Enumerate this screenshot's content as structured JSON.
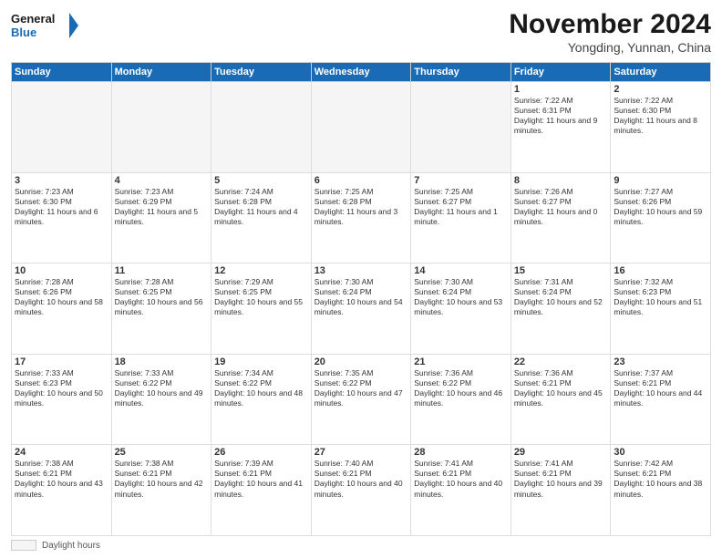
{
  "logo": {
    "line1": "General",
    "line2": "Blue"
  },
  "title": "November 2024",
  "subtitle": "Yongding, Yunnan, China",
  "days_of_week": [
    "Sunday",
    "Monday",
    "Tuesday",
    "Wednesday",
    "Thursday",
    "Friday",
    "Saturday"
  ],
  "footer_label": "Daylight hours",
  "weeks": [
    [
      {
        "day": "",
        "info": ""
      },
      {
        "day": "",
        "info": ""
      },
      {
        "day": "",
        "info": ""
      },
      {
        "day": "",
        "info": ""
      },
      {
        "day": "",
        "info": ""
      },
      {
        "day": "1",
        "info": "Sunrise: 7:22 AM\nSunset: 6:31 PM\nDaylight: 11 hours and 9 minutes."
      },
      {
        "day": "2",
        "info": "Sunrise: 7:22 AM\nSunset: 6:30 PM\nDaylight: 11 hours and 8 minutes."
      }
    ],
    [
      {
        "day": "3",
        "info": "Sunrise: 7:23 AM\nSunset: 6:30 PM\nDaylight: 11 hours and 6 minutes."
      },
      {
        "day": "4",
        "info": "Sunrise: 7:23 AM\nSunset: 6:29 PM\nDaylight: 11 hours and 5 minutes."
      },
      {
        "day": "5",
        "info": "Sunrise: 7:24 AM\nSunset: 6:28 PM\nDaylight: 11 hours and 4 minutes."
      },
      {
        "day": "6",
        "info": "Sunrise: 7:25 AM\nSunset: 6:28 PM\nDaylight: 11 hours and 3 minutes."
      },
      {
        "day": "7",
        "info": "Sunrise: 7:25 AM\nSunset: 6:27 PM\nDaylight: 11 hours and 1 minute."
      },
      {
        "day": "8",
        "info": "Sunrise: 7:26 AM\nSunset: 6:27 PM\nDaylight: 11 hours and 0 minutes."
      },
      {
        "day": "9",
        "info": "Sunrise: 7:27 AM\nSunset: 6:26 PM\nDaylight: 10 hours and 59 minutes."
      }
    ],
    [
      {
        "day": "10",
        "info": "Sunrise: 7:28 AM\nSunset: 6:26 PM\nDaylight: 10 hours and 58 minutes."
      },
      {
        "day": "11",
        "info": "Sunrise: 7:28 AM\nSunset: 6:25 PM\nDaylight: 10 hours and 56 minutes."
      },
      {
        "day": "12",
        "info": "Sunrise: 7:29 AM\nSunset: 6:25 PM\nDaylight: 10 hours and 55 minutes."
      },
      {
        "day": "13",
        "info": "Sunrise: 7:30 AM\nSunset: 6:24 PM\nDaylight: 10 hours and 54 minutes."
      },
      {
        "day": "14",
        "info": "Sunrise: 7:30 AM\nSunset: 6:24 PM\nDaylight: 10 hours and 53 minutes."
      },
      {
        "day": "15",
        "info": "Sunrise: 7:31 AM\nSunset: 6:24 PM\nDaylight: 10 hours and 52 minutes."
      },
      {
        "day": "16",
        "info": "Sunrise: 7:32 AM\nSunset: 6:23 PM\nDaylight: 10 hours and 51 minutes."
      }
    ],
    [
      {
        "day": "17",
        "info": "Sunrise: 7:33 AM\nSunset: 6:23 PM\nDaylight: 10 hours and 50 minutes."
      },
      {
        "day": "18",
        "info": "Sunrise: 7:33 AM\nSunset: 6:22 PM\nDaylight: 10 hours and 49 minutes."
      },
      {
        "day": "19",
        "info": "Sunrise: 7:34 AM\nSunset: 6:22 PM\nDaylight: 10 hours and 48 minutes."
      },
      {
        "day": "20",
        "info": "Sunrise: 7:35 AM\nSunset: 6:22 PM\nDaylight: 10 hours and 47 minutes."
      },
      {
        "day": "21",
        "info": "Sunrise: 7:36 AM\nSunset: 6:22 PM\nDaylight: 10 hours and 46 minutes."
      },
      {
        "day": "22",
        "info": "Sunrise: 7:36 AM\nSunset: 6:21 PM\nDaylight: 10 hours and 45 minutes."
      },
      {
        "day": "23",
        "info": "Sunrise: 7:37 AM\nSunset: 6:21 PM\nDaylight: 10 hours and 44 minutes."
      }
    ],
    [
      {
        "day": "24",
        "info": "Sunrise: 7:38 AM\nSunset: 6:21 PM\nDaylight: 10 hours and 43 minutes."
      },
      {
        "day": "25",
        "info": "Sunrise: 7:38 AM\nSunset: 6:21 PM\nDaylight: 10 hours and 42 minutes."
      },
      {
        "day": "26",
        "info": "Sunrise: 7:39 AM\nSunset: 6:21 PM\nDaylight: 10 hours and 41 minutes."
      },
      {
        "day": "27",
        "info": "Sunrise: 7:40 AM\nSunset: 6:21 PM\nDaylight: 10 hours and 40 minutes."
      },
      {
        "day": "28",
        "info": "Sunrise: 7:41 AM\nSunset: 6:21 PM\nDaylight: 10 hours and 40 minutes."
      },
      {
        "day": "29",
        "info": "Sunrise: 7:41 AM\nSunset: 6:21 PM\nDaylight: 10 hours and 39 minutes."
      },
      {
        "day": "30",
        "info": "Sunrise: 7:42 AM\nSunset: 6:21 PM\nDaylight: 10 hours and 38 minutes."
      }
    ]
  ]
}
